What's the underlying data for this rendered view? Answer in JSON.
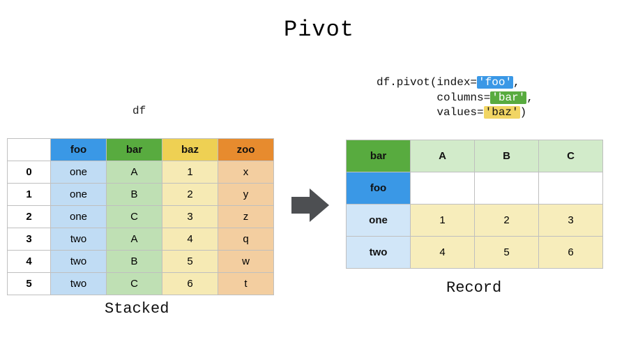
{
  "title": "Pivot",
  "left": {
    "label": "df",
    "caption": "Stacked",
    "columns": [
      "foo",
      "bar",
      "baz",
      "zoo"
    ],
    "index": [
      "0",
      "1",
      "2",
      "3",
      "4",
      "5"
    ],
    "rows": [
      {
        "foo": "one",
        "bar": "A",
        "baz": "1",
        "zoo": "x"
      },
      {
        "foo": "one",
        "bar": "B",
        "baz": "2",
        "zoo": "y"
      },
      {
        "foo": "one",
        "bar": "C",
        "baz": "3",
        "zoo": "z"
      },
      {
        "foo": "two",
        "bar": "A",
        "baz": "4",
        "zoo": "q"
      },
      {
        "foo": "two",
        "bar": "B",
        "baz": "5",
        "zoo": "w"
      },
      {
        "foo": "two",
        "bar": "C",
        "baz": "6",
        "zoo": "t"
      }
    ]
  },
  "code": {
    "prefix": "df.pivot(index=",
    "arg_index": "'foo'",
    "mid1": ",",
    "pad": "         columns=",
    "arg_columns": "'bar'",
    "mid2": ",",
    "pad2": "         values=",
    "arg_values": "'baz'",
    "suffix": ")"
  },
  "right": {
    "caption": "Record",
    "corner_top": "bar",
    "corner_side": "foo",
    "col_headers": [
      "A",
      "B",
      "C"
    ],
    "row_headers": [
      "one",
      "two"
    ],
    "values": [
      [
        "1",
        "2",
        "3"
      ],
      [
        "4",
        "5",
        "6"
      ]
    ]
  },
  "colors": {
    "foo": "#3a98e6",
    "bar": "#58ab3f",
    "baz": "#eed053",
    "zoo": "#e78b2e",
    "foo_light": "#c0dcf4",
    "bar_light": "#bfe0b4",
    "baz_light": "#f6eab4",
    "zoo_light": "#f3cea0"
  }
}
